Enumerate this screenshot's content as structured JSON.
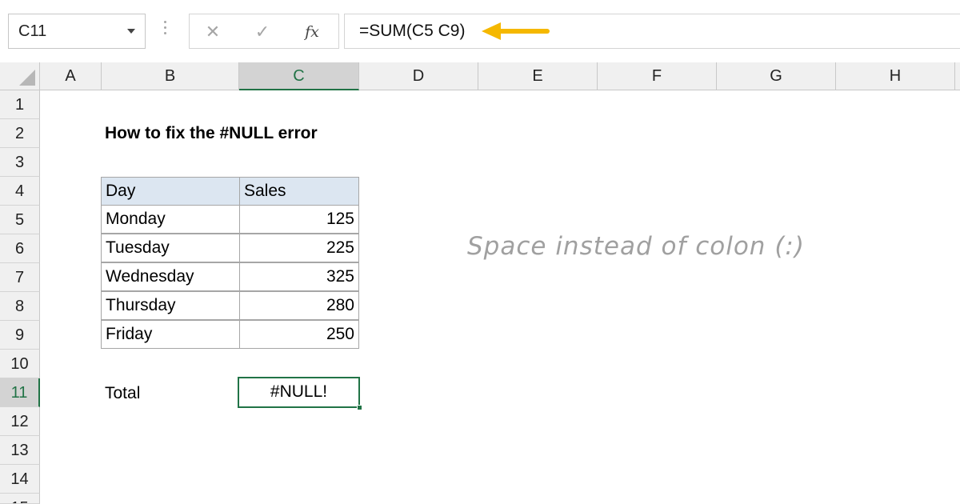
{
  "formula_bar": {
    "name_box": "C11",
    "cancel_glyph": "✕",
    "enter_glyph": "✓",
    "fx_label": "fx",
    "formula": "=SUM(C5 C9)",
    "arrow_color": "#f5b800"
  },
  "columns": [
    "A",
    "B",
    "C",
    "D",
    "E",
    "F",
    "G",
    "H"
  ],
  "active_column": "C",
  "rows": [
    "1",
    "2",
    "3",
    "4",
    "5",
    "6",
    "7",
    "8",
    "9",
    "10",
    "11",
    "12",
    "13",
    "14",
    "15"
  ],
  "active_row": "11",
  "sheet": {
    "title": "How to fix the #NULL error",
    "table": {
      "headers": [
        "Day",
        "Sales"
      ],
      "rows": [
        [
          "Monday",
          "125"
        ],
        [
          "Tuesday",
          "225"
        ],
        [
          "Wednesday",
          "325"
        ],
        [
          "Thursday",
          "280"
        ],
        [
          "Friday",
          "250"
        ]
      ]
    },
    "total_label": "Total",
    "total_value": "#NULL!",
    "annotation": "Space instead of colon (:)"
  },
  "colors": {
    "accent": "#217346",
    "header_fill": "#dce6f1"
  }
}
